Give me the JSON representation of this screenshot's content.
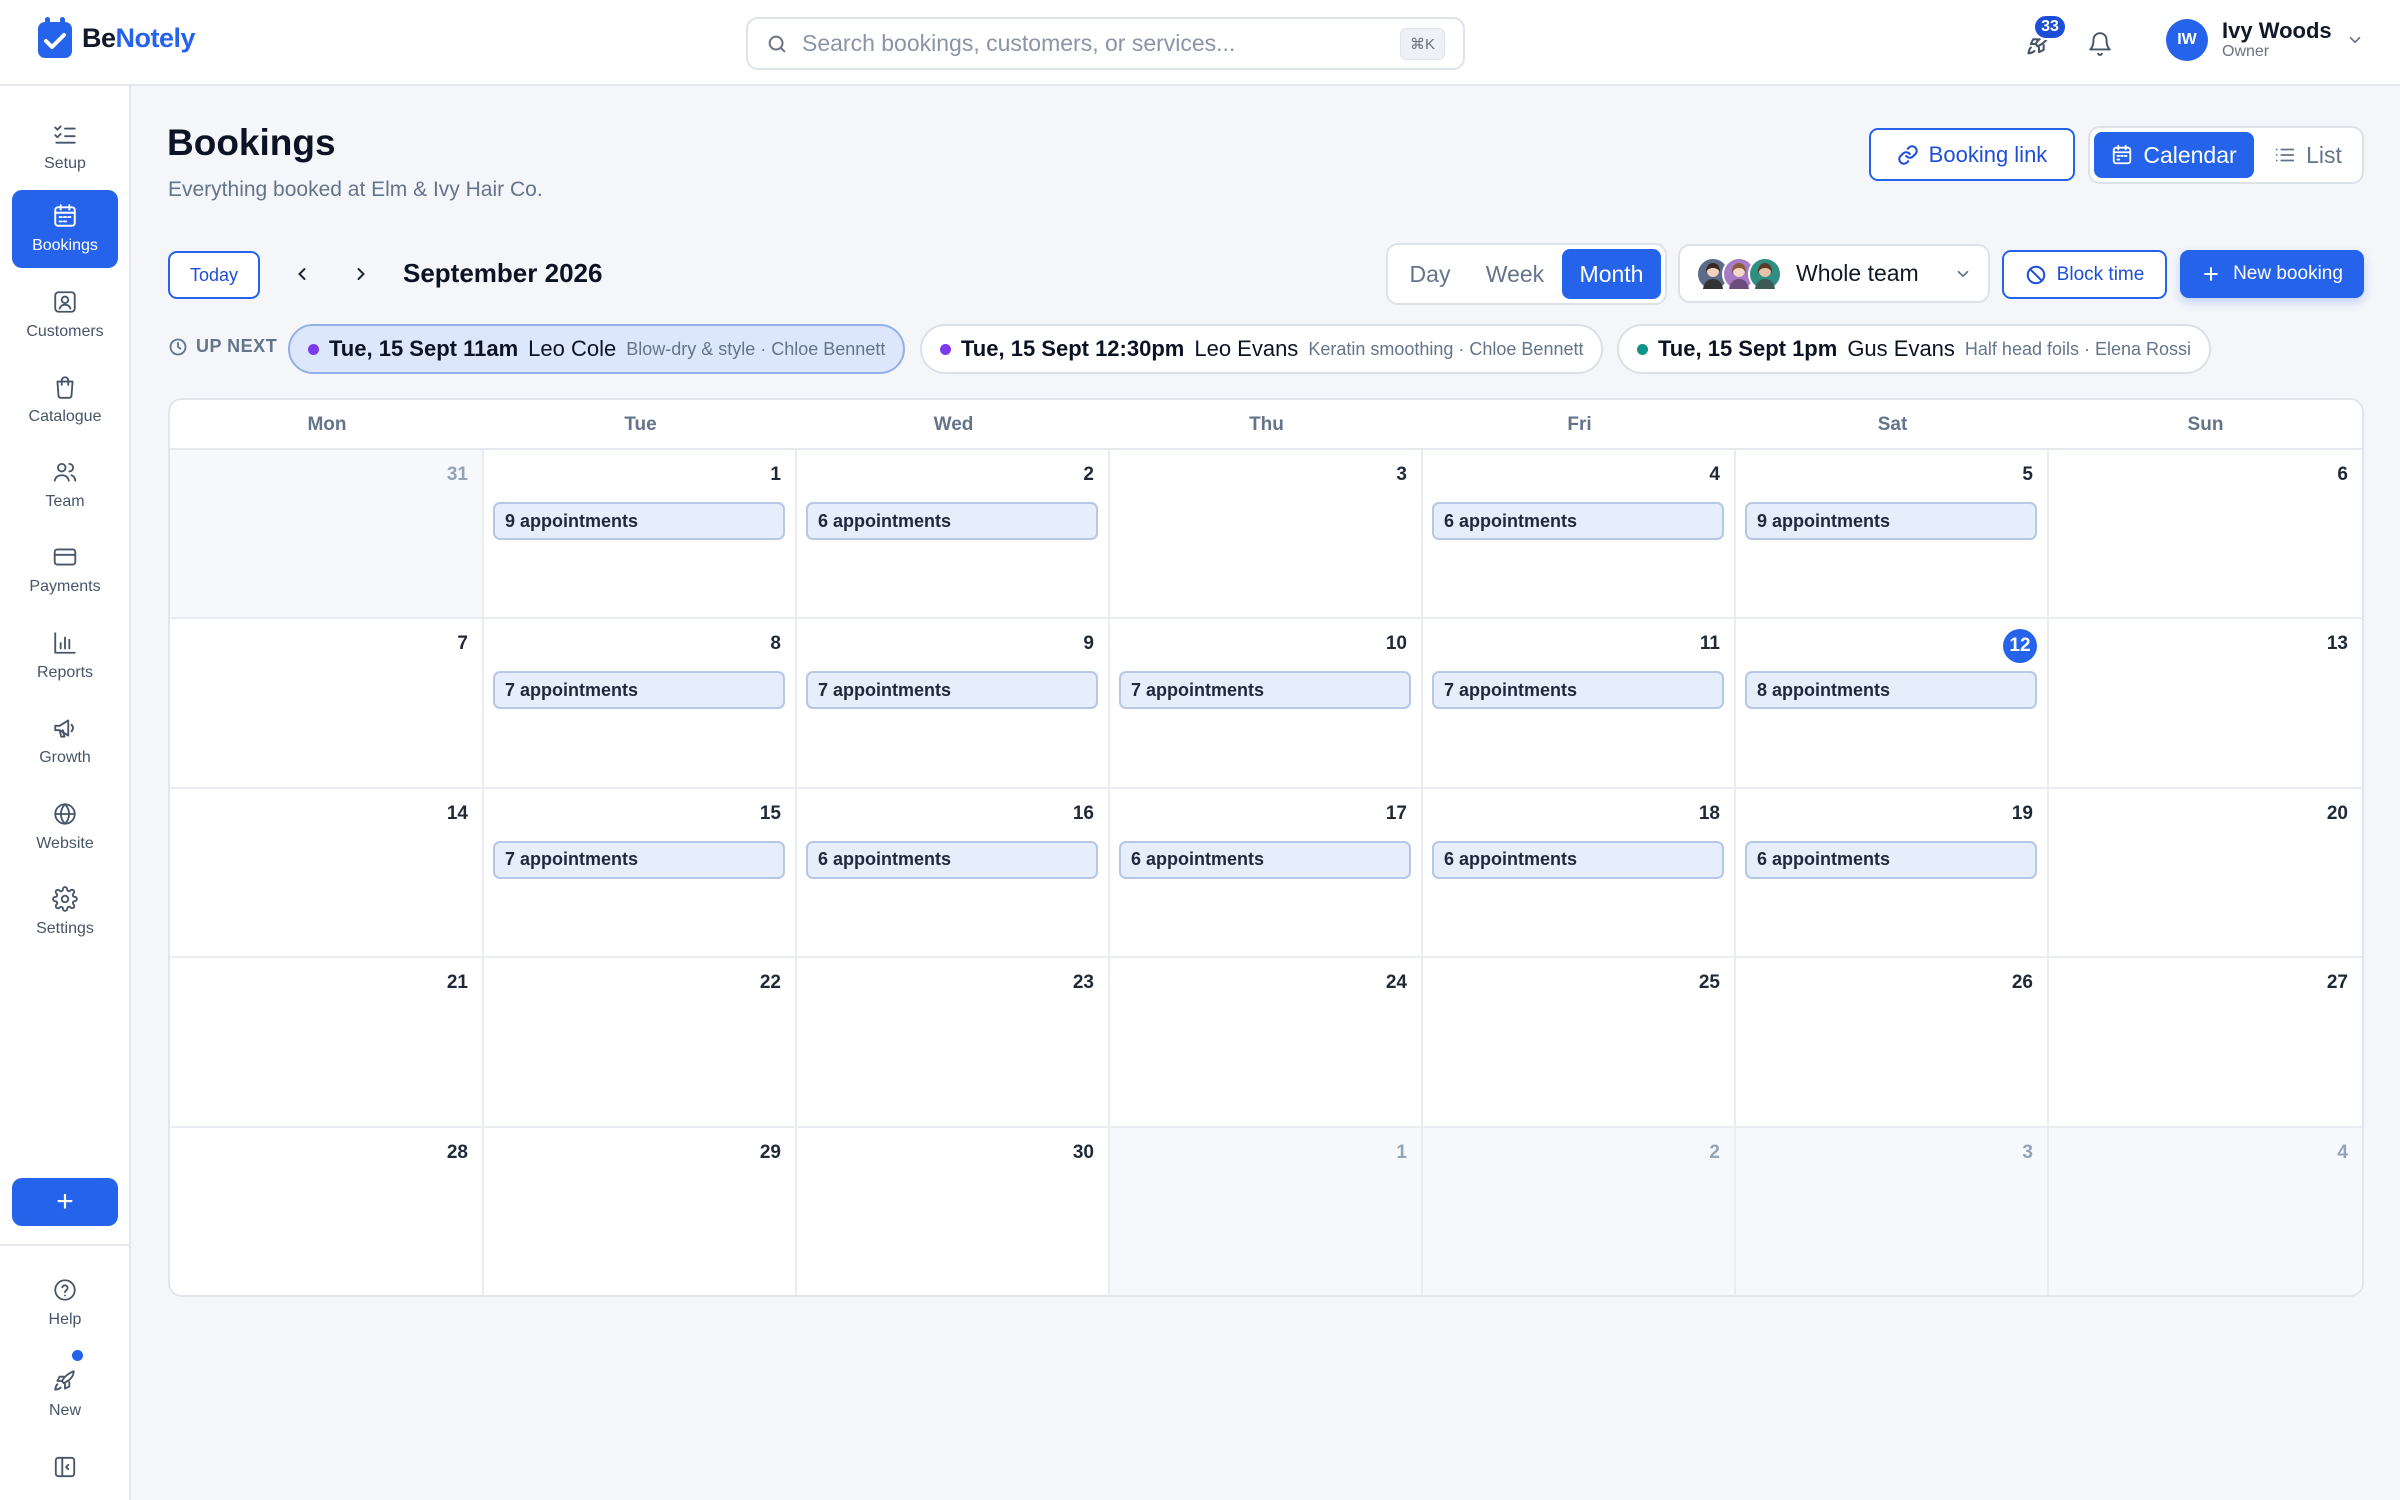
{
  "app": {
    "logo_be": "Be",
    "logo_notely": "Notely"
  },
  "search": {
    "placeholder": "Search bookings, customers, or services...",
    "shortcut": "⌘K"
  },
  "header": {
    "notification_count": "33",
    "user_initials": "IW",
    "user_name": "Ivy Woods",
    "user_role": "Owner"
  },
  "sidebar": {
    "items": [
      {
        "label": "Setup",
        "icon": "checklist-icon",
        "active": false
      },
      {
        "label": "Bookings",
        "icon": "calendar-icon",
        "active": true
      },
      {
        "label": "Customers",
        "icon": "contact-card-icon",
        "active": false
      },
      {
        "label": "Catalogue",
        "icon": "shopping-bag-icon",
        "active": false
      },
      {
        "label": "Team",
        "icon": "people-icon",
        "active": false
      },
      {
        "label": "Payments",
        "icon": "credit-card-icon",
        "active": false
      },
      {
        "label": "Reports",
        "icon": "bar-chart-icon",
        "active": false
      },
      {
        "label": "Growth",
        "icon": "megaphone-icon",
        "active": false
      },
      {
        "label": "Website",
        "icon": "globe-icon",
        "active": false
      },
      {
        "label": "Settings",
        "icon": "gear-icon",
        "active": false
      }
    ],
    "add_label": "+",
    "help_label": "Help",
    "new_label": "New"
  },
  "page": {
    "title": "Bookings",
    "subtitle": "Everything booked at Elm & Ivy Hair Co."
  },
  "toolbar": {
    "booking_link": "Booking link",
    "view_calendar": "Calendar",
    "view_list": "List",
    "today": "Today",
    "month_label": "September 2026",
    "range_day": "Day",
    "range_week": "Week",
    "range_month": "Month",
    "team_filter": "Whole team",
    "block_time": "Block time",
    "new_booking": "New booking"
  },
  "up_next": {
    "label": "UP NEXT",
    "items": [
      {
        "when": "Tue, 15 Sept 11am",
        "customer": "Leo Cole",
        "detail": "Blow-dry & style · Chloe Bennett",
        "color": "#7c3aed"
      },
      {
        "when": "Tue, 15 Sept 12:30pm",
        "customer": "Leo Evans",
        "detail": "Keratin smoothing · Chloe Bennett",
        "color": "#7c3aed"
      },
      {
        "when": "Tue, 15 Sept 1pm",
        "customer": "Gus Evans",
        "detail": "Half head foils · Elena Rossi",
        "color": "#0d9488"
      }
    ]
  },
  "calendar": {
    "weekdays": [
      "Mon",
      "Tue",
      "Wed",
      "Thu",
      "Fri",
      "Sat",
      "Sun"
    ],
    "weeks": [
      [
        {
          "day": "31",
          "outside": true
        },
        {
          "day": "1",
          "appts": "9 appointments"
        },
        {
          "day": "2",
          "appts": "6 appointments"
        },
        {
          "day": "3"
        },
        {
          "day": "4",
          "appts": "6 appointments"
        },
        {
          "day": "5",
          "appts": "9 appointments"
        },
        {
          "day": "6"
        }
      ],
      [
        {
          "day": "7"
        },
        {
          "day": "8",
          "appts": "7 appointments"
        },
        {
          "day": "9",
          "appts": "7 appointments"
        },
        {
          "day": "10",
          "appts": "7 appointments"
        },
        {
          "day": "11",
          "appts": "7 appointments"
        },
        {
          "day": "12",
          "appts": "8 appointments",
          "today": true
        },
        {
          "day": "13"
        }
      ],
      [
        {
          "day": "14"
        },
        {
          "day": "15",
          "appts": "7 appointments"
        },
        {
          "day": "16",
          "appts": "6 appointments"
        },
        {
          "day": "17",
          "appts": "6 appointments"
        },
        {
          "day": "18",
          "appts": "6 appointments"
        },
        {
          "day": "19",
          "appts": "6 appointments"
        },
        {
          "day": "20"
        }
      ],
      [
        {
          "day": "21"
        },
        {
          "day": "22"
        },
        {
          "day": "23"
        },
        {
          "day": "24"
        },
        {
          "day": "25"
        },
        {
          "day": "26"
        },
        {
          "day": "27"
        }
      ],
      [
        {
          "day": "28"
        },
        {
          "day": "29"
        },
        {
          "day": "30"
        },
        {
          "day": "1",
          "outside": true
        },
        {
          "day": "2",
          "outside": true
        },
        {
          "day": "3",
          "outside": true
        },
        {
          "day": "4",
          "outside": true
        }
      ]
    ]
  },
  "colors": {
    "accent": "#2563eb",
    "team_avatar_1": "#5b6b8a",
    "team_avatar_2": "#a77bc4",
    "team_avatar_3": "#2f8f83"
  }
}
